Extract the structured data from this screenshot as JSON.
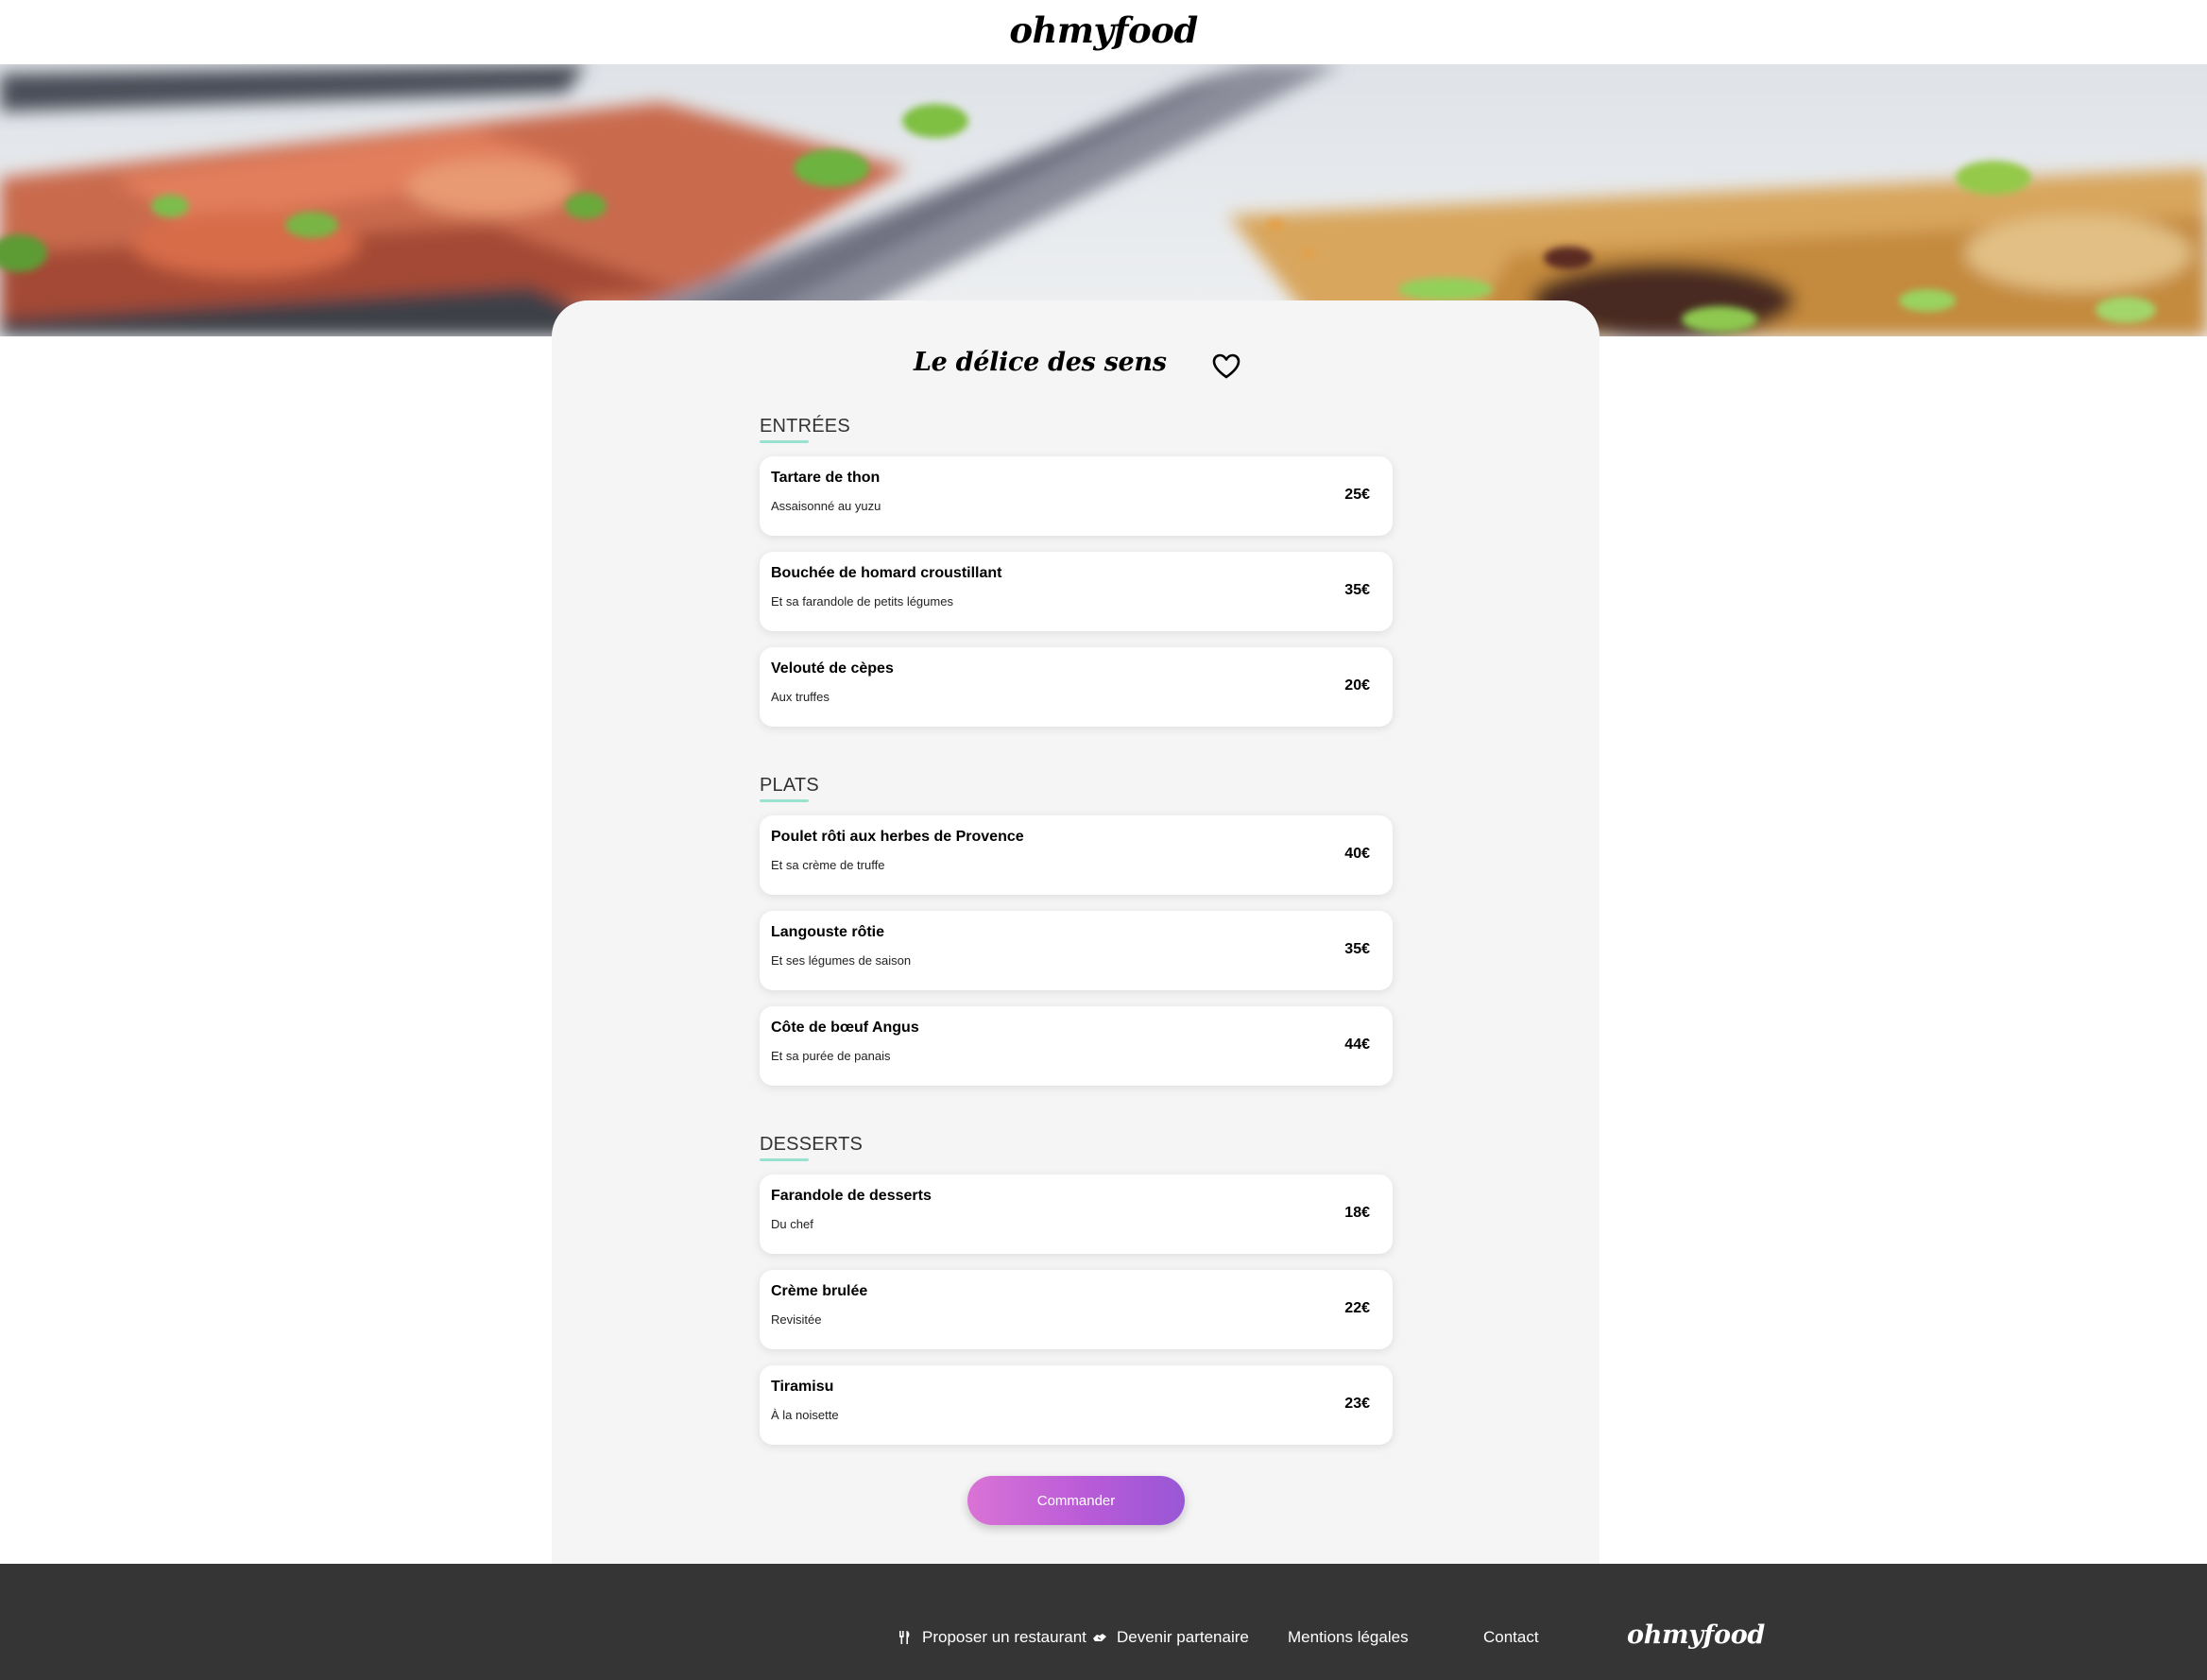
{
  "header": {
    "logo": "ohmyfood"
  },
  "restaurant": {
    "name": "Le délice des sens"
  },
  "sections": [
    {
      "title": "ENTRÉES",
      "dishes": [
        {
          "name": "Tartare de thon",
          "desc": "Assaisonné au yuzu",
          "price": "25€"
        },
        {
          "name": "Bouchée de homard croustillant",
          "desc": "Et sa farandole de petits légumes",
          "price": "35€"
        },
        {
          "name": "Velouté de cèpes",
          "desc": "Aux truffes",
          "price": "20€"
        }
      ]
    },
    {
      "title": "PLATS",
      "dishes": [
        {
          "name": "Poulet rôti aux herbes de Provence",
          "desc": "Et sa crème de truffe",
          "price": "40€"
        },
        {
          "name": "Langouste rôtie",
          "desc": "Et ses légumes de saison",
          "price": "35€"
        },
        {
          "name": "Côte de bœuf Angus",
          "desc": "Et sa purée de panais",
          "price": "44€"
        }
      ]
    },
    {
      "title": "DESSERTS",
      "dishes": [
        {
          "name": "Farandole de desserts",
          "desc": "Du chef",
          "price": "18€"
        },
        {
          "name": "Crème brulée",
          "desc": "Revisitée",
          "price": "22€"
        },
        {
          "name": "Tiramisu",
          "desc": "À la noisette",
          "price": "23€"
        }
      ]
    }
  ],
  "order_button": {
    "label": "Commander"
  },
  "footer": {
    "links": [
      {
        "label": "Proposer un restaurant",
        "icon": "utensils-icon"
      },
      {
        "label": "Devenir partenaire",
        "icon": "handshake-icon"
      },
      {
        "label": "Mentions légales"
      },
      {
        "label": "Contact"
      }
    ],
    "logo": "ohmyfood"
  },
  "colors": {
    "accent_underline": "#99e2d0",
    "button_gradient_start": "#da73d6",
    "button_gradient_end": "#9857d6",
    "footer_bg": "#353535",
    "card_bg": "#f5f5f5"
  }
}
